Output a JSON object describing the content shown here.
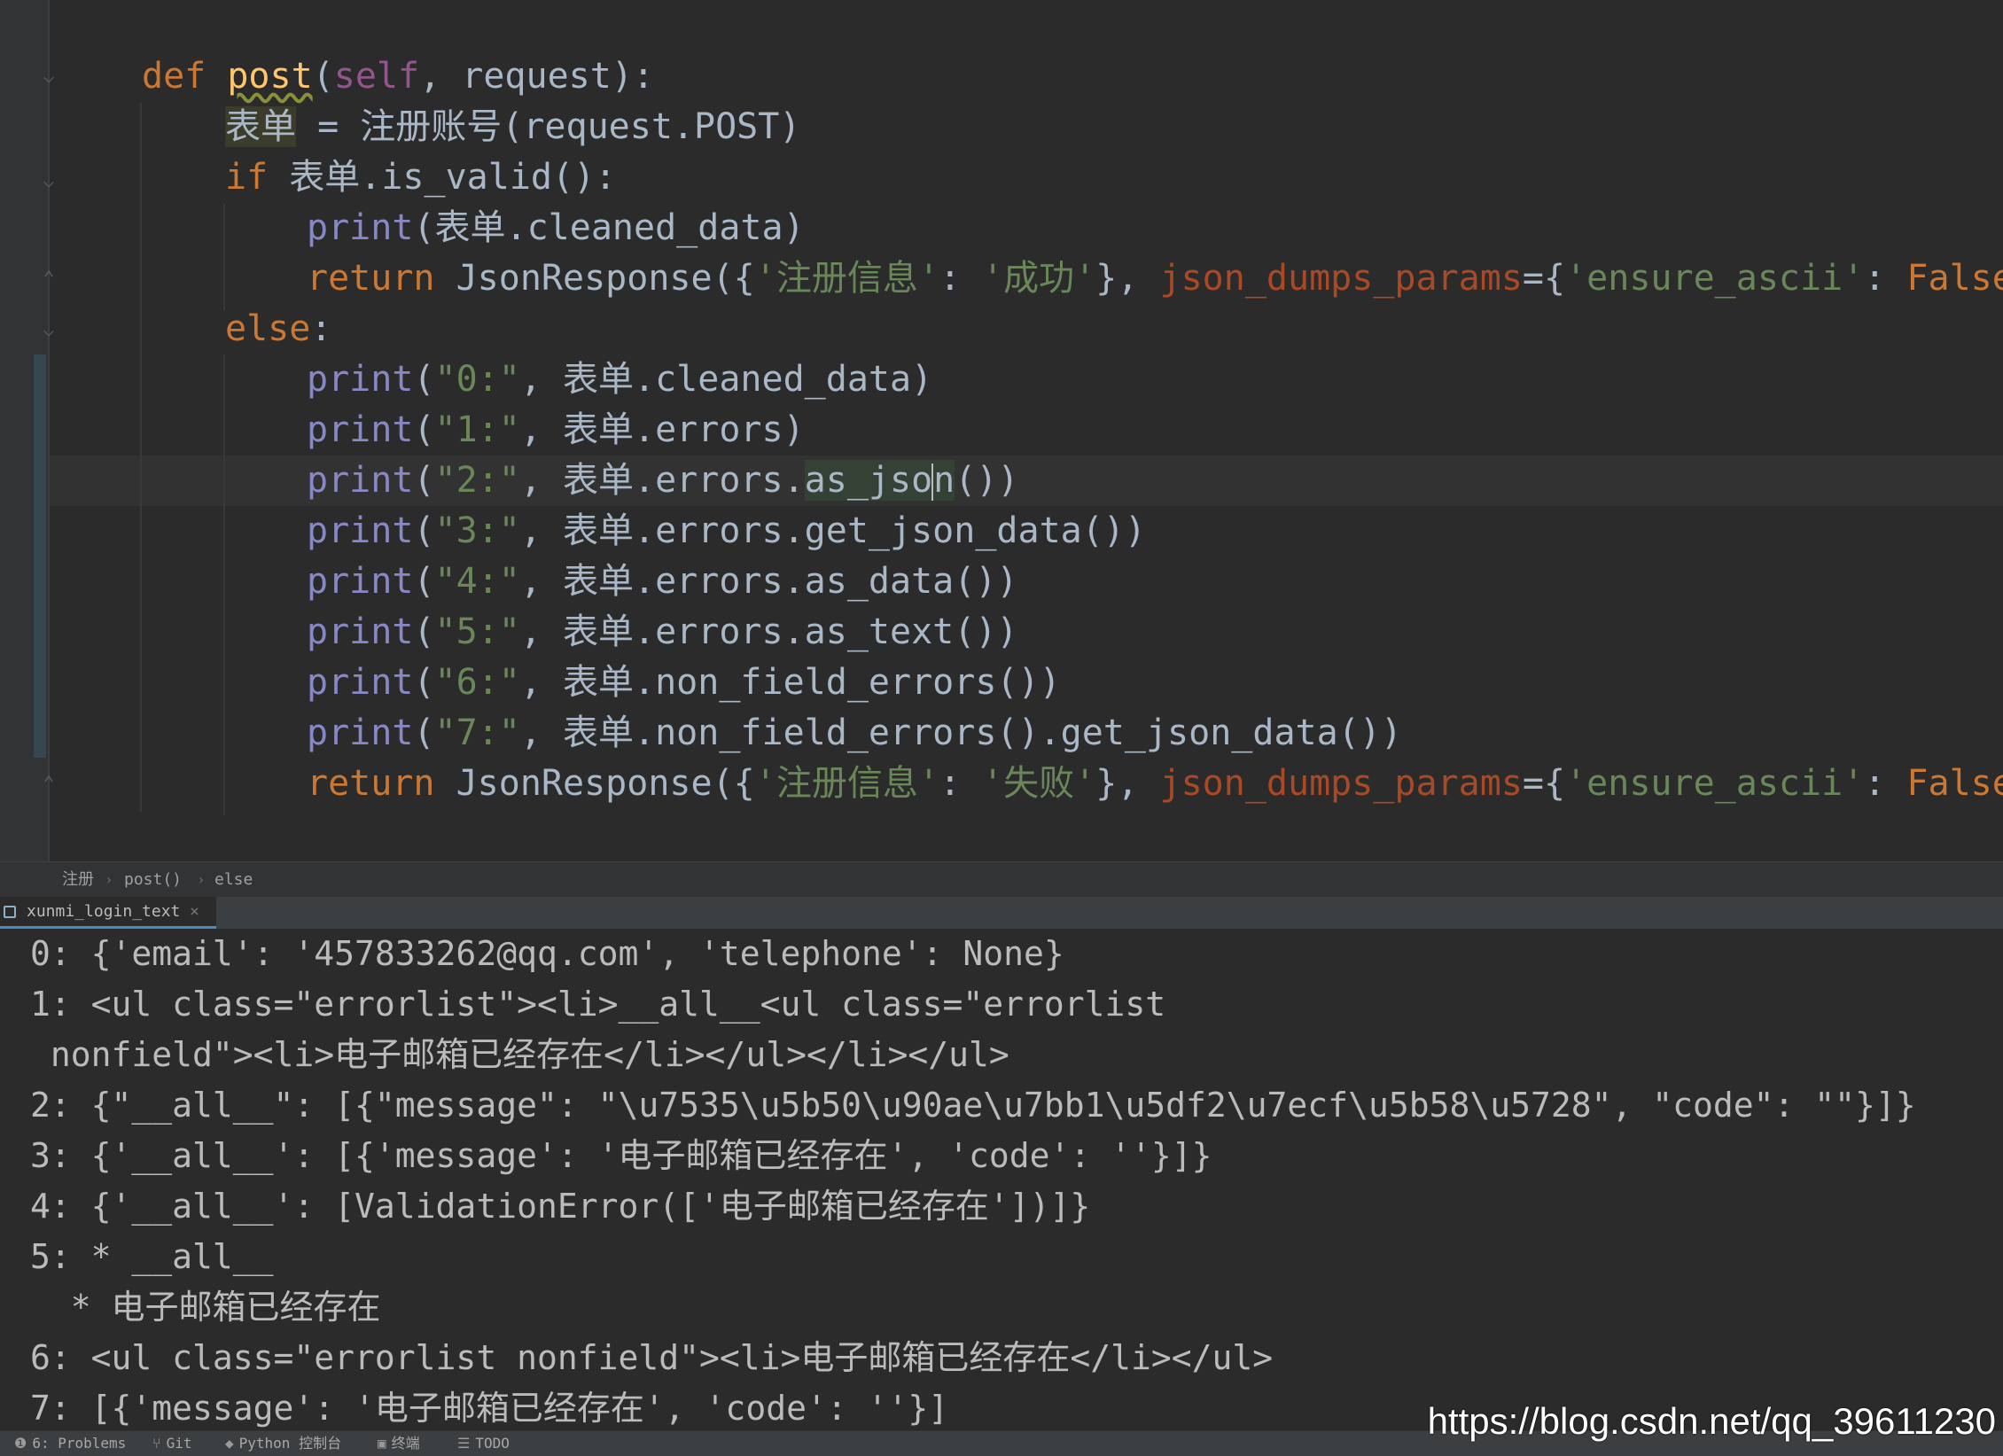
{
  "editor": {
    "lines": [
      {
        "indent": 0,
        "tokens": [
          {
            "t": "def ",
            "c": "kw"
          },
          {
            "t": "post",
            "c": "fn"
          },
          {
            "t": "(",
            "c": ""
          },
          {
            "t": "self",
            "c": "self"
          },
          {
            "t": ", request):",
            "c": ""
          }
        ]
      },
      {
        "indent": 1,
        "tokens": [
          {
            "t": "表单",
            "c": "hl-var"
          },
          {
            "t": " = 注册账号(request.POST)",
            "c": ""
          }
        ]
      },
      {
        "indent": 1,
        "tokens": [
          {
            "t": "if ",
            "c": "kw"
          },
          {
            "t": "表单.is_valid():",
            "c": ""
          }
        ]
      },
      {
        "indent": 2,
        "tokens": [
          {
            "t": "print",
            "c": "bi"
          },
          {
            "t": "(表单.cleaned_data)",
            "c": ""
          }
        ]
      },
      {
        "indent": 2,
        "tokens": [
          {
            "t": "return ",
            "c": "kw"
          },
          {
            "t": "JsonResponse({",
            "c": ""
          },
          {
            "t": "'注册信息'",
            "c": "str"
          },
          {
            "t": ": ",
            "c": ""
          },
          {
            "t": "'成功'",
            "c": "str"
          },
          {
            "t": "}, ",
            "c": ""
          },
          {
            "t": "json_dumps_params",
            "c": "param"
          },
          {
            "t": "={",
            "c": ""
          },
          {
            "t": "'ensure_ascii'",
            "c": "str"
          },
          {
            "t": ": ",
            "c": ""
          },
          {
            "t": "False",
            "c": "kw"
          },
          {
            "t": "})",
            "c": ""
          }
        ]
      },
      {
        "indent": 1,
        "tokens": [
          {
            "t": "else",
            "c": "kw"
          },
          {
            "t": ":",
            "c": ""
          }
        ]
      },
      {
        "indent": 2,
        "tokens": [
          {
            "t": "print",
            "c": "bi"
          },
          {
            "t": "(",
            "c": ""
          },
          {
            "t": "\"0:\"",
            "c": "str"
          },
          {
            "t": ", 表单.cleaned_data)",
            "c": ""
          }
        ]
      },
      {
        "indent": 2,
        "tokens": [
          {
            "t": "print",
            "c": "bi"
          },
          {
            "t": "(",
            "c": ""
          },
          {
            "t": "\"1:\"",
            "c": "str"
          },
          {
            "t": ", 表单.errors)",
            "c": ""
          }
        ]
      },
      {
        "indent": 2,
        "tokens": [
          {
            "t": "print",
            "c": "bi"
          },
          {
            "t": "(",
            "c": ""
          },
          {
            "t": "\"2:\"",
            "c": "str"
          },
          {
            "t": ", 表单.errors.",
            "c": ""
          },
          {
            "t": "as_jso",
            "c": "hl-word"
          },
          {
            "t": "|",
            "c": "caret"
          },
          {
            "t": "n",
            "c": "hl-word"
          },
          {
            "t": "())",
            "c": ""
          }
        ]
      },
      {
        "indent": 2,
        "tokens": [
          {
            "t": "print",
            "c": "bi"
          },
          {
            "t": "(",
            "c": ""
          },
          {
            "t": "\"3:\"",
            "c": "str"
          },
          {
            "t": ", 表单.errors.get_json_data())",
            "c": ""
          }
        ]
      },
      {
        "indent": 2,
        "tokens": [
          {
            "t": "print",
            "c": "bi"
          },
          {
            "t": "(",
            "c": ""
          },
          {
            "t": "\"4:\"",
            "c": "str"
          },
          {
            "t": ", 表单.errors.as_data())",
            "c": ""
          }
        ]
      },
      {
        "indent": 2,
        "tokens": [
          {
            "t": "print",
            "c": "bi"
          },
          {
            "t": "(",
            "c": ""
          },
          {
            "t": "\"5:\"",
            "c": "str"
          },
          {
            "t": ", 表单.errors.as_text())",
            "c": ""
          }
        ]
      },
      {
        "indent": 2,
        "tokens": [
          {
            "t": "print",
            "c": "bi"
          },
          {
            "t": "(",
            "c": ""
          },
          {
            "t": "\"6:\"",
            "c": "str"
          },
          {
            "t": ", 表单.non_field_errors())",
            "c": ""
          }
        ]
      },
      {
        "indent": 2,
        "tokens": [
          {
            "t": "print",
            "c": "bi"
          },
          {
            "t": "(",
            "c": ""
          },
          {
            "t": "\"7:\"",
            "c": "str"
          },
          {
            "t": ", 表单.non_field_errors().get_json_data())",
            "c": ""
          }
        ]
      },
      {
        "indent": 2,
        "tokens": [
          {
            "t": "return ",
            "c": "kw"
          },
          {
            "t": "JsonResponse({",
            "c": ""
          },
          {
            "t": "'注册信息'",
            "c": "str"
          },
          {
            "t": ": ",
            "c": ""
          },
          {
            "t": "'失败'",
            "c": "str"
          },
          {
            "t": "}, ",
            "c": ""
          },
          {
            "t": "json_dumps_params",
            "c": "param"
          },
          {
            "t": "={",
            "c": ""
          },
          {
            "t": "'ensure_ascii'",
            "c": "str"
          },
          {
            "t": ": ",
            "c": ""
          },
          {
            "t": "False",
            "c": "kw"
          },
          {
            "t": "})",
            "c": ""
          }
        ]
      }
    ]
  },
  "breadcrumb": {
    "items": [
      "注册",
      "post()",
      "else"
    ]
  },
  "run_panel": {
    "tab_label": "xunmi_login_text",
    "close_icon": "×"
  },
  "console": {
    "lines": [
      "0: {'email': '457833262@qq.com', 'telephone': None}",
      "1: <ul class=\"errorlist\"><li>__all__<ul class=\"errorlist",
      " nonfield\"><li>电子邮箱已经存在</li></ul></li></ul>",
      "2: {\"__all__\": [{\"message\": \"\\u7535\\u5b50\\u90ae\\u7bb1\\u5df2\\u7ecf\\u5b58\\u5728\", \"code\": \"\"}]}",
      "3: {'__all__': [{'message': '电子邮箱已经存在', 'code': ''}]}",
      "4: {'__all__': [ValidationError(['电子邮箱已经存在'])]}",
      "5: * __all__",
      "  * 电子邮箱已经存在",
      "6: <ul class=\"errorlist nonfield\"><li>电子邮箱已经存在</li></ul>",
      "7: [{'message': '电子邮箱已经存在', 'code': ''}]"
    ]
  },
  "statusbar": {
    "problems": "6: Problems",
    "git": "Git",
    "python_console": "Python 控制台",
    "terminal": "终端",
    "todo": "TODO",
    "icons": {
      "problems": "info-icon",
      "git": "git-branch-icon",
      "python_console": "python-icon",
      "terminal": "terminal-icon",
      "todo": "list-icon"
    }
  },
  "watermark": "https://blog.csdn.net/qq_39611230",
  "colors": {
    "background": "#2b2b2b",
    "keyword": "#cc7832",
    "string": "#6a8759",
    "builtin": "#8888c6",
    "function": "#ffc66d",
    "self": "#94558d",
    "param": "#aa4926",
    "text": "#a9b7c6"
  }
}
